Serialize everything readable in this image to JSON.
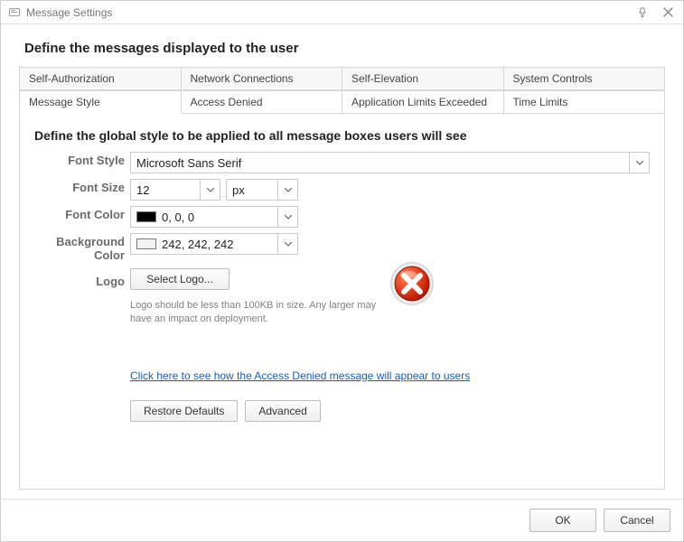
{
  "window": {
    "title": "Message Settings"
  },
  "page": {
    "title": "Define the messages displayed to the user"
  },
  "tabs_row1": [
    {
      "label": "Self-Authorization"
    },
    {
      "label": "Network Connections"
    },
    {
      "label": "Self-Elevation"
    },
    {
      "label": "System Controls"
    }
  ],
  "tabs_row2": [
    {
      "label": "Message Style"
    },
    {
      "label": "Access Denied"
    },
    {
      "label": "Application Limits Exceeded"
    },
    {
      "label": "Time Limits"
    }
  ],
  "section": {
    "heading": "Define the global style to be applied to all message boxes users will see",
    "labels": {
      "fontStyle": "Font Style",
      "fontSize": "Font Size",
      "fontColor": "Font Color",
      "backgroundColor": "Background Color",
      "logo": "Logo"
    },
    "fontStyle": {
      "value": "Microsoft Sans Serif"
    },
    "fontSize": {
      "value": "12",
      "unit": "px"
    },
    "fontColor": {
      "text": "0, 0, 0",
      "hex": "#000000"
    },
    "backgroundColor": {
      "text": "242, 242, 242",
      "hex": "#f2f2f2"
    },
    "logo": {
      "buttonLabel": "Select Logo...",
      "hint": "Logo should be less than 100KB in size. Any larger may have an impact on deployment."
    },
    "previewLink": "Click here to see how the Access Denied message will appear to users",
    "buttons": {
      "restoreDefaults": "Restore Defaults",
      "advanced": "Advanced"
    }
  },
  "footer": {
    "ok": "OK",
    "cancel": "Cancel"
  }
}
